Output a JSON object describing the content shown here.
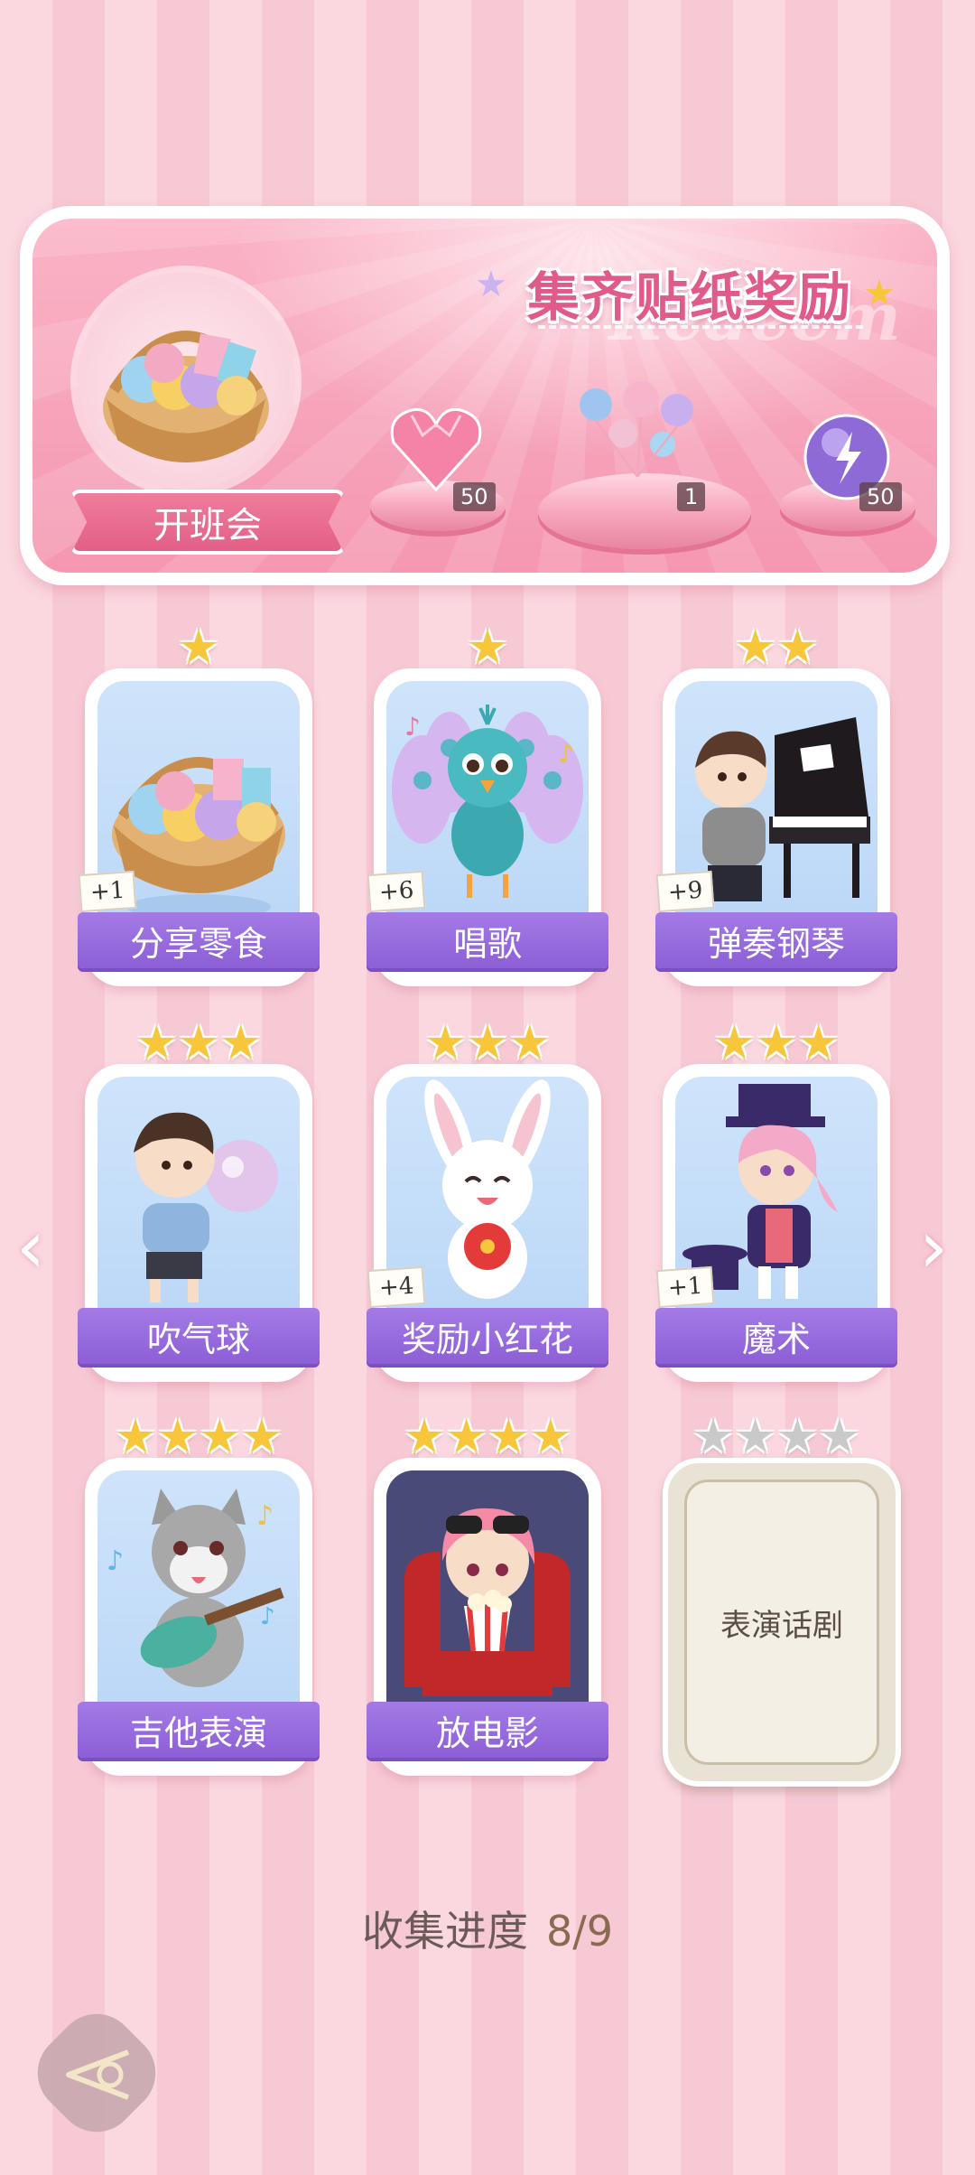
{
  "banner": {
    "title": "集齐贴纸奖励",
    "watermark": "Redeem",
    "event_name": "开班会",
    "rewards": [
      {
        "icon": "pink-heart-gem-icon",
        "count": "50"
      },
      {
        "icon": "balloon-bundle-icon",
        "count": "1"
      },
      {
        "icon": "purple-energy-orb-icon",
        "count": "50"
      }
    ]
  },
  "cards": [
    {
      "label": "分享零食",
      "stars": 1,
      "bonus": "+1",
      "art": "snack-basket"
    },
    {
      "label": "唱歌",
      "stars": 1,
      "bonus": "+6",
      "art": "peacock"
    },
    {
      "label": "弹奏钢琴",
      "stars": 2,
      "bonus": "+9",
      "art": "piano-boy"
    },
    {
      "label": "吹气球",
      "stars": 3,
      "bonus": "",
      "art": "balloon-boy"
    },
    {
      "label": "奖励小红花",
      "stars": 3,
      "bonus": "+4",
      "art": "bunny"
    },
    {
      "label": "魔术",
      "stars": 3,
      "bonus": "+1",
      "art": "magician"
    },
    {
      "label": "吉他表演",
      "stars": 4,
      "bonus": "",
      "art": "wolf-guitar"
    },
    {
      "label": "放电影",
      "stars": 4,
      "bonus": "",
      "art": "movie-girl"
    },
    {
      "label": "表演话剧",
      "stars": 4,
      "bonus": "",
      "art": "locked",
      "locked": true
    }
  ],
  "progress": {
    "label": "收集进度",
    "value": "8/9",
    "collected": 8,
    "total": 9
  },
  "colors": {
    "accent_pink": "#e05a8a",
    "label_purple": "#8c5fd6",
    "star_gold": "#f7c63a"
  }
}
